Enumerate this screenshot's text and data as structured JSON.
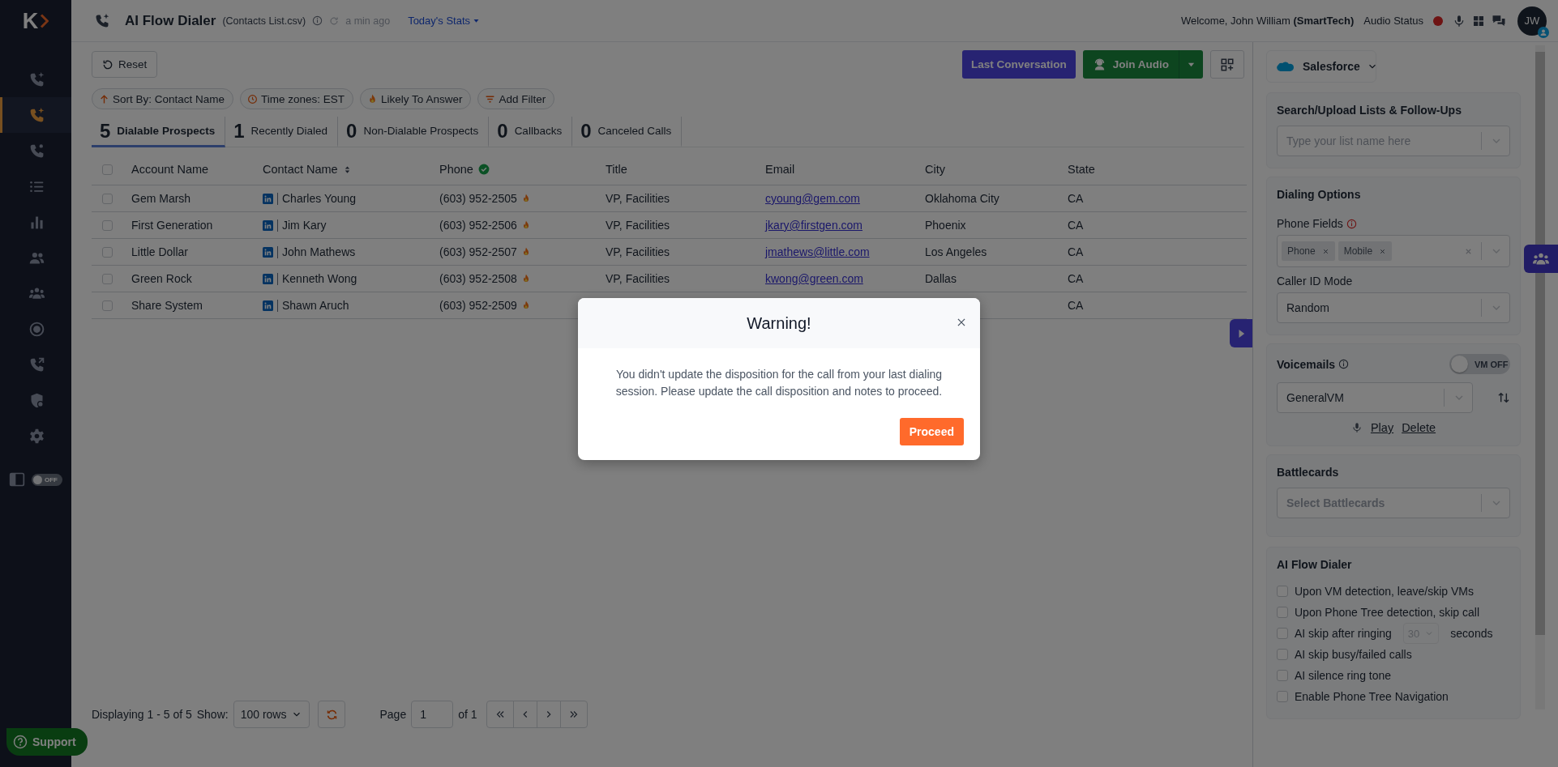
{
  "sidebar": {
    "logo": "K",
    "items": [
      {
        "selected": false
      },
      {
        "selected": true
      },
      {
        "selected": false
      },
      {
        "selected": false
      },
      {
        "selected": false
      },
      {
        "selected": false
      },
      {
        "selected": false
      },
      {
        "selected": false
      },
      {
        "selected": false
      },
      {
        "selected": false
      },
      {
        "selected": false
      }
    ],
    "panel_toggle": {
      "label": "OFF",
      "on": false
    },
    "support": "Support"
  },
  "topbar": {
    "title": "AI Flow Dialer",
    "file": "(Contacts List.csv)",
    "updated": "a min ago",
    "stats_link": "Today's Stats",
    "welcome": "Welcome, John William **(SmartTech)**",
    "audio_status": "Audio Status",
    "avatar": "JW"
  },
  "toolbar": {
    "reset": "Reset",
    "last_conversation": "Last Conversation",
    "join_audio": "Join Audio"
  },
  "filters": [
    {
      "kind": "sort",
      "label": "Sort By: Contact Name"
    },
    {
      "kind": "time",
      "label": "Time zones: EST"
    },
    {
      "kind": "fire",
      "label": "Likely To Answer"
    },
    {
      "kind": "filter",
      "label": "Add Filter"
    }
  ],
  "tabs": [
    {
      "count": "5",
      "label": "Dialable Prospects",
      "selected": true
    },
    {
      "count": "1",
      "label": "Recently Dialed",
      "selected": false
    },
    {
      "count": "0",
      "label": "Non-Dialable Prospects",
      "selected": false
    },
    {
      "count": "0",
      "label": "Callbacks",
      "selected": false
    },
    {
      "count": "0",
      "label": "Canceled Calls",
      "selected": false
    }
  ],
  "table": {
    "columns": [
      {
        "label": "Account Name"
      },
      {
        "label": "Contact Name",
        "kind": "sortable"
      },
      {
        "label": "Phone",
        "kind": "verified"
      },
      {
        "label": "Title"
      },
      {
        "label": "Email"
      },
      {
        "label": "City"
      },
      {
        "label": "State"
      }
    ],
    "rows": [
      {
        "selected": false,
        "account": "Gem Marsh",
        "contact": "Charles Young",
        "phone": "(603) 952-2505",
        "title": "VP, Facilities",
        "email": "cyoung@gem.com",
        "city": "Oklahoma City",
        "state": "CA"
      },
      {
        "selected": false,
        "account": "First Generation",
        "contact": "Jim Kary",
        "phone": "(603) 952-2506",
        "title": "VP, Facilities",
        "email": "jkary@firstgen.com",
        "city": "Phoenix",
        "state": "CA"
      },
      {
        "selected": false,
        "account": "Little Dollar",
        "contact": "John Mathews",
        "phone": "(603) 952-2507",
        "title": "VP, Facilities",
        "email": "jmathews@little.com",
        "city": "Los Angeles",
        "state": "CA"
      },
      {
        "selected": false,
        "account": "Green Rock",
        "contact": "Kenneth Wong",
        "phone": "(603) 952-2508",
        "title": "VP, Facilities",
        "email": "kwong@green.com",
        "city": "Dallas",
        "state": "CA"
      },
      {
        "selected": false,
        "account": "Share System",
        "contact": "Shawn Aruch",
        "phone": "(603) 952-2509",
        "state": "CA"
      }
    ],
    "select_all": false
  },
  "pagination": {
    "displaying": "Displaying 1 - 5 of 5",
    "show_label": "Show:",
    "rows": "100 rows",
    "page_label": "Page",
    "page": "1",
    "of": "of 1"
  },
  "panel": {
    "crm": "Salesforce",
    "lists": {
      "title": "Search/Upload Lists & Follow-Ups",
      "placeholder": "Type your list name here"
    },
    "dialing": {
      "title": "Dialing Options",
      "phone_fields_label": "Phone Fields",
      "phone_fields": [
        "Phone",
        "Mobile"
      ],
      "caller_id_label": "Caller ID Mode",
      "caller_id": "Random"
    },
    "voicemails": {
      "title": "Voicemails",
      "toggle": {
        "label": "VM OFF",
        "on": false
      },
      "selected": "GeneralVM",
      "play": "Play",
      "delete": "Delete"
    },
    "battlecards": {
      "title": "Battlecards",
      "placeholder": "Select Battlecards"
    },
    "ai_dialer": {
      "title": "AI Flow Dialer",
      "options": [
        {
          "kind": "check",
          "label": "Upon VM detection, leave/skip VMs",
          "checked": false
        },
        {
          "kind": "check",
          "label": "Upon Phone Tree detection, skip call",
          "checked": false
        },
        {
          "kind": "timer",
          "label": "AI skip after ringing",
          "value": "30",
          "suffix": "seconds",
          "checked": false
        },
        {
          "kind": "check",
          "label": "AI skip busy/failed calls",
          "checked": false
        },
        {
          "kind": "check",
          "label": "AI silence ring tone",
          "checked": false
        },
        {
          "kind": "check",
          "label": "Enable Phone Tree Navigation",
          "checked": false
        }
      ]
    }
  },
  "modal": {
    "title": "Warning!",
    "message": "You didn't update the disposition for the call from your last dialing session. Please update the call disposition and notes to proceed.",
    "button": "Proceed"
  }
}
